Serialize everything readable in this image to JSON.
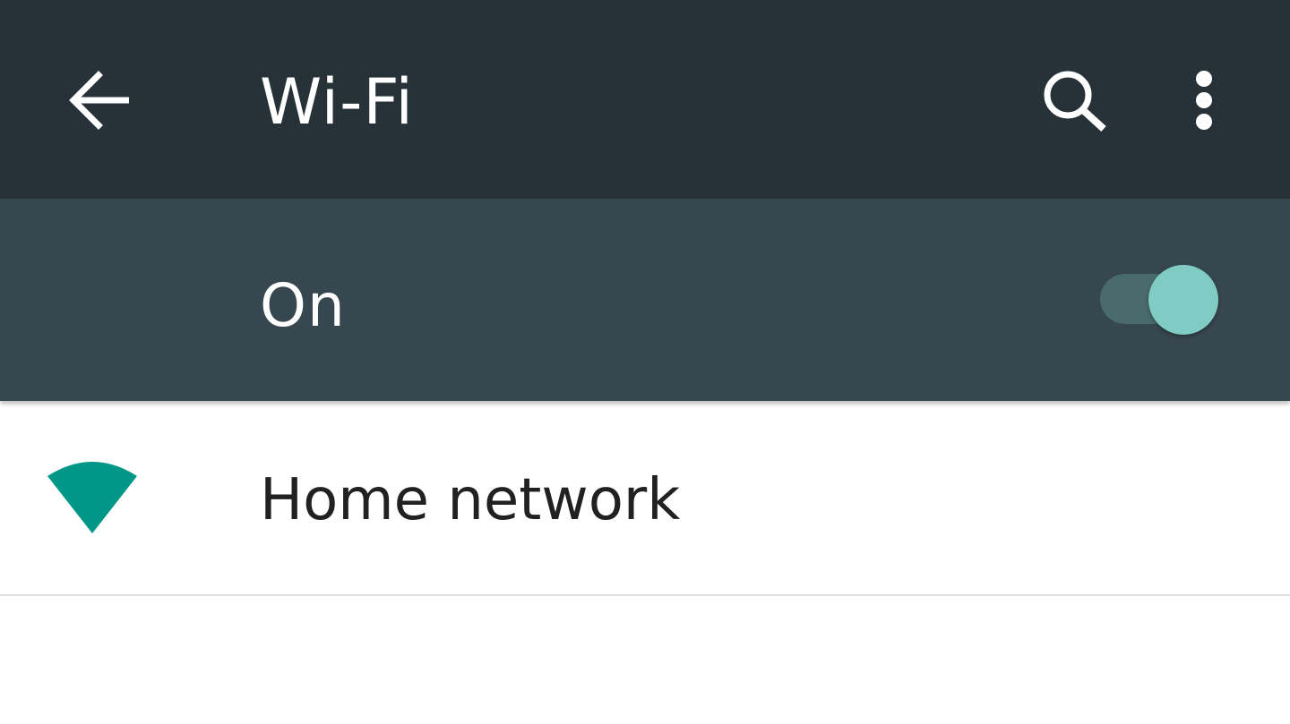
{
  "toolbar": {
    "title": "Wi-Fi",
    "back_icon": "arrow-back-icon",
    "search_icon": "search-icon",
    "more_icon": "more-vert-icon"
  },
  "switch_bar": {
    "label": "On",
    "state": "on"
  },
  "networks": [
    {
      "name": "Home network",
      "icon": "wifi-signal-icon"
    }
  ],
  "colors": {
    "toolbar_bg": "#263238",
    "switchbar_bg": "#37474f",
    "toggle_thumb": "#80cbc4",
    "toggle_track": "#4a6b6c",
    "wifi_accent": "#009688",
    "text_on_dark": "#ffffff",
    "text_primary": "#212121"
  }
}
